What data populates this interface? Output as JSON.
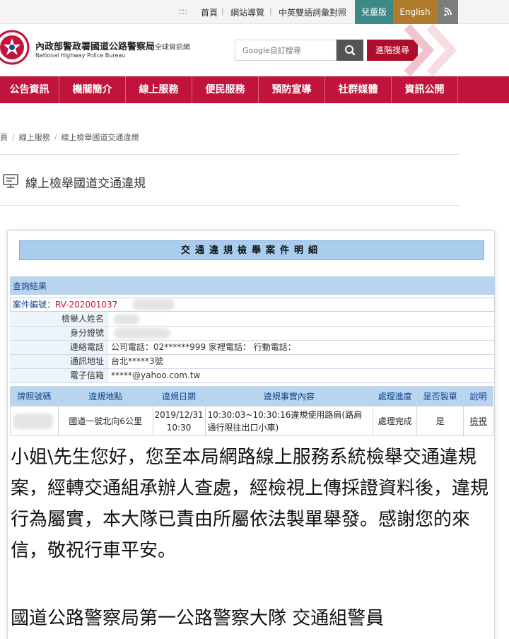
{
  "topbar": {
    "dots": ":::",
    "links": [
      "首頁",
      "網站導覽",
      "中英雙語詞彙對照"
    ],
    "kids": "兒童版",
    "english": "English",
    "rss_icon": "rss-icon"
  },
  "header": {
    "agency_cn": "內政部警政署國道公路警察局",
    "agency_suffix": "全球資訊網",
    "agency_en": "National Highway Police Bureau",
    "search_placeholder": "Google自訂搜尋",
    "advanced_search": "進階搜尋",
    "colors": {
      "brand_red": "#c0143c",
      "kids": "#3b8a87",
      "english": "#b07b2c"
    }
  },
  "nav": {
    "items": [
      "公告資訊",
      "機關簡介",
      "線上服務",
      "便民服務",
      "預防宣導",
      "社群媒體",
      "資訊公開"
    ]
  },
  "breadcrumb": {
    "items": [
      "頁",
      "線上服務",
      "線上檢舉國道交通違規"
    ],
    "separator": "/"
  },
  "page": {
    "title": "線上檢舉國道交通違規"
  },
  "case": {
    "title": "交通違規檢舉案件明細",
    "query_label": "查詢結果",
    "case_no_label": "案件編號：",
    "case_no_value": "RV-202001037",
    "fields": [
      {
        "label": "檢舉人姓名",
        "value": ""
      },
      {
        "label": "身分證號",
        "value": ""
      },
      {
        "label": "連絡電話",
        "value": "公司電話：02******999  家裡電話：  行動電話："
      },
      {
        "label": "通訊地址",
        "value": "台北*****3號"
      },
      {
        "label": "電子信箱",
        "value": "*****@yahoo.com.tw"
      }
    ],
    "table": {
      "headers": [
        "牌照號碼",
        "違規地點",
        "違規日期",
        "違規事實內容",
        "處理進度",
        "是否製單",
        "說明"
      ],
      "row": {
        "plate": "",
        "location": "國道一號北向6公里",
        "date_line1": "2019/12/31",
        "date_line2": "10:30",
        "content_line1": "10:30:03~10:30:16違規使用路肩(路肩",
        "content_line2": "通行限往出口小車)",
        "status": "處理完成",
        "ticketed": "是",
        "detail": "檢視"
      }
    },
    "reply": "小姐\\先生您好，您至本局網路線上服務系統檢舉交通違規案，經轉交通組承辦人查處，經檢視上傳採證資料後，違規行為屬實，本大隊已責由所屬依法製單舉發。感謝您的來信，敬祝行車平安。",
    "signature": "國道公路警察局第一公路警察大隊 交通組警員"
  }
}
